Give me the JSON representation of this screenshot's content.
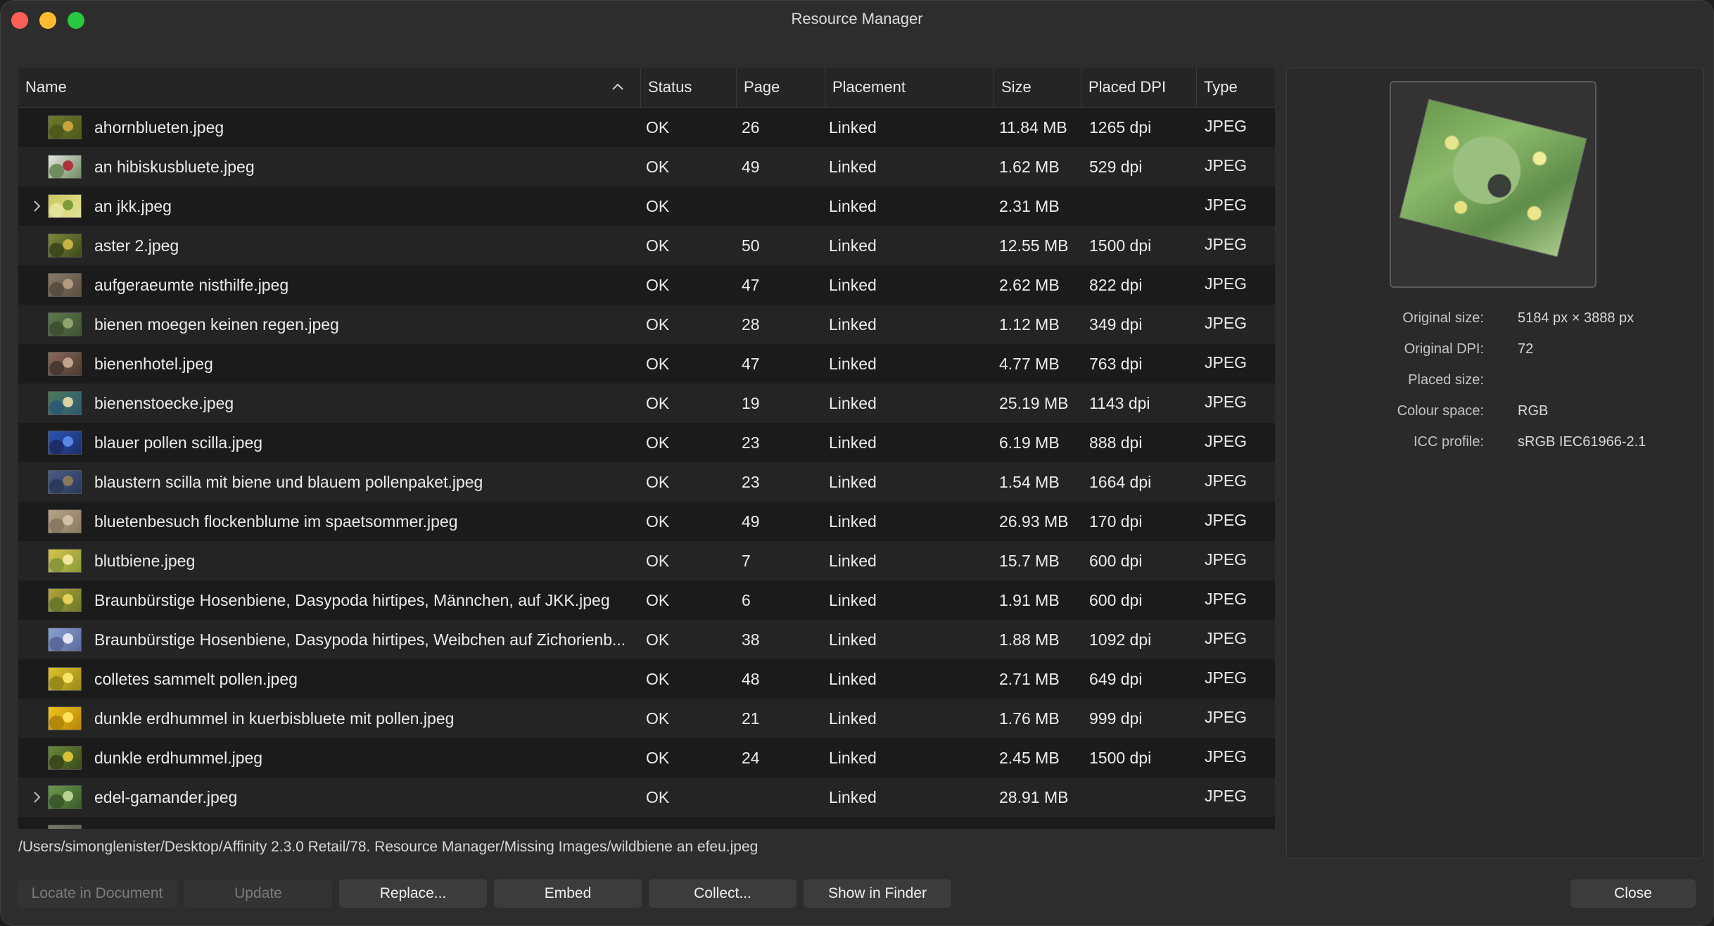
{
  "window": {
    "title": "Resource Manager"
  },
  "table": {
    "columns": {
      "name": "Name",
      "status": "Status",
      "page": "Page",
      "placement": "Placement",
      "size": "Size",
      "dpi": "Placed DPI",
      "type": "Type"
    },
    "rows": [
      {
        "name": "ahornblueten.jpeg",
        "status": "OK",
        "page": "26",
        "placement": "Linked",
        "size": "11.84 MB",
        "dpi": "1265 dpi",
        "type": "JPEG",
        "expandable": false,
        "thumb": [
          "#6d7a2a",
          "#c8a23a",
          "#4d5a1c"
        ]
      },
      {
        "name": "an hibiskusbluete.jpeg",
        "status": "OK",
        "page": "49",
        "placement": "Linked",
        "size": "1.62 MB",
        "dpi": "529 dpi",
        "type": "JPEG",
        "expandable": false,
        "thumb": [
          "#e4e4e4",
          "#b0323a",
          "#6e8d5c"
        ]
      },
      {
        "name": "an jkk.jpeg",
        "status": "OK",
        "page": "",
        "placement": "Linked",
        "size": "2.31 MB",
        "dpi": "",
        "type": "JPEG",
        "expandable": true,
        "thumb": [
          "#c9c65a",
          "#7f9a3a",
          "#e5e39a"
        ]
      },
      {
        "name": "aster 2.jpeg",
        "status": "OK",
        "page": "50",
        "placement": "Linked",
        "size": "12.55 MB",
        "dpi": "1500 dpi",
        "type": "JPEG",
        "expandable": false,
        "thumb": [
          "#7d8a3a",
          "#c9b246",
          "#3f4a1c"
        ]
      },
      {
        "name": "aufgeraeumte nisthilfe.jpeg",
        "status": "OK",
        "page": "47",
        "placement": "Linked",
        "size": "2.62 MB",
        "dpi": "822 dpi",
        "type": "JPEG",
        "expandable": false,
        "thumb": [
          "#8a7a68",
          "#b49a7e",
          "#5a4e40"
        ]
      },
      {
        "name": "bienen moegen keinen regen.jpeg",
        "status": "OK",
        "page": "28",
        "placement": "Linked",
        "size": "1.12 MB",
        "dpi": "349 dpi",
        "type": "JPEG",
        "expandable": false,
        "thumb": [
          "#5f7a4e",
          "#8fa36e",
          "#3e5230"
        ]
      },
      {
        "name": "bienenhotel.jpeg",
        "status": "OK",
        "page": "47",
        "placement": "Linked",
        "size": "4.77 MB",
        "dpi": "763 dpi",
        "type": "JPEG",
        "expandable": false,
        "thumb": [
          "#8c6a5a",
          "#c2a48e",
          "#4a3a30"
        ]
      },
      {
        "name": "bienenstoecke.jpeg",
        "status": "OK",
        "page": "19",
        "placement": "Linked",
        "size": "25.19 MB",
        "dpi": "1143 dpi",
        "type": "JPEG",
        "expandable": false,
        "thumb": [
          "#4a7a5a",
          "#d9d3a6",
          "#2f5a74"
        ]
      },
      {
        "name": "blauer pollen scilla.jpeg",
        "status": "OK",
        "page": "23",
        "placement": "Linked",
        "size": "6.19 MB",
        "dpi": "888 dpi",
        "type": "JPEG",
        "expandable": false,
        "thumb": [
          "#2a56b4",
          "#5a86e4",
          "#1c2e6a"
        ]
      },
      {
        "name": "blaustern scilla mit biene und blauem pollenpaket.jpeg",
        "status": "OK",
        "page": "23",
        "placement": "Linked",
        "size": "1.54 MB",
        "dpi": "1664 dpi",
        "type": "JPEG",
        "expandable": false,
        "thumb": [
          "#4a5a8a",
          "#8a7a5a",
          "#2a3a5a"
        ]
      },
      {
        "name": "bluetenbesuch flockenblume im spaetsommer.jpeg",
        "status": "OK",
        "page": "49",
        "placement": "Linked",
        "size": "26.93 MB",
        "dpi": "170 dpi",
        "type": "JPEG",
        "expandable": false,
        "thumb": [
          "#b8a486",
          "#d2c0a6",
          "#8a7a62"
        ]
      },
      {
        "name": "blutbiene.jpeg",
        "status": "OK",
        "page": "7",
        "placement": "Linked",
        "size": "15.7 MB",
        "dpi": "600 dpi",
        "type": "JPEG",
        "expandable": false,
        "thumb": [
          "#d6c44a",
          "#f0e6a0",
          "#8a9a3a"
        ]
      },
      {
        "name": "Braunbürstige Hosenbiene, Dasypoda hirtipes, Männchen, auf JKK.jpeg",
        "status": "OK",
        "page": "6",
        "placement": "Linked",
        "size": "1.91 MB",
        "dpi": "600 dpi",
        "type": "JPEG",
        "expandable": false,
        "thumb": [
          "#b4a43a",
          "#e2d25e",
          "#6a7a2a"
        ]
      },
      {
        "name": "Braunbürstige Hosenbiene, Dasypoda hirtipes, Weibchen auf Zichorienb...",
        "status": "OK",
        "page": "38",
        "placement": "Linked",
        "size": "1.88 MB",
        "dpi": "1092 dpi",
        "type": "JPEG",
        "expandable": false,
        "thumb": [
          "#8aa2d6",
          "#e6e6f0",
          "#5a6a9a"
        ]
      },
      {
        "name": "colletes sammelt pollen.jpeg",
        "status": "OK",
        "page": "48",
        "placement": "Linked",
        "size": "2.71 MB",
        "dpi": "649 dpi",
        "type": "JPEG",
        "expandable": false,
        "thumb": [
          "#e2c22a",
          "#f6e46a",
          "#9a8a1a"
        ]
      },
      {
        "name": "dunkle erdhummel in kuerbisbluete mit pollen.jpeg",
        "status": "OK",
        "page": "21",
        "placement": "Linked",
        "size": "1.76 MB",
        "dpi": "999 dpi",
        "type": "JPEG",
        "expandable": false,
        "thumb": [
          "#f2c41a",
          "#ffe25a",
          "#b4860a"
        ]
      },
      {
        "name": "dunkle erdhummel.jpeg",
        "status": "OK",
        "page": "24",
        "placement": "Linked",
        "size": "2.45 MB",
        "dpi": "1500 dpi",
        "type": "JPEG",
        "expandable": false,
        "thumb": [
          "#6a8a3a",
          "#d6c23a",
          "#3a4a1a"
        ]
      },
      {
        "name": "edel-gamander.jpeg",
        "status": "OK",
        "page": "",
        "placement": "Linked",
        "size": "28.91 MB",
        "dpi": "",
        "type": "JPEG",
        "expandable": true,
        "thumb": [
          "#6a9a4a",
          "#b6d28e",
          "#3a5a2a"
        ]
      },
      {
        "name": "",
        "status": "",
        "page": "",
        "placement": "",
        "size": "",
        "dpi": "",
        "type": "",
        "expandable": false,
        "thumb": [
          "#7a7a6a",
          "#9a9a8a",
          "#5a5a4a"
        ]
      }
    ]
  },
  "path": "/Users/simonglenister/Desktop/Affinity 2.3.0 Retail/78. Resource Manager/Missing Images/wildbiene an efeu.jpeg",
  "buttons": {
    "locate": "Locate in Document",
    "update": "Update",
    "replace": "Replace...",
    "embed": "Embed",
    "collect": "Collect...",
    "show_in_finder": "Show in Finder",
    "close": "Close"
  },
  "details": {
    "original_size_label": "Original size:",
    "original_size": "5184 px × 3888 px",
    "original_dpi_label": "Original DPI:",
    "original_dpi": "72",
    "placed_size_label": "Placed size:",
    "placed_size": "",
    "colour_space_label": "Colour space:",
    "colour_space": "RGB",
    "icc_label": "ICC profile:",
    "icc": "sRGB IEC61966-2.1"
  },
  "icons": {
    "sort": "chevron-up-icon",
    "expander": "chevron-right-icon"
  }
}
